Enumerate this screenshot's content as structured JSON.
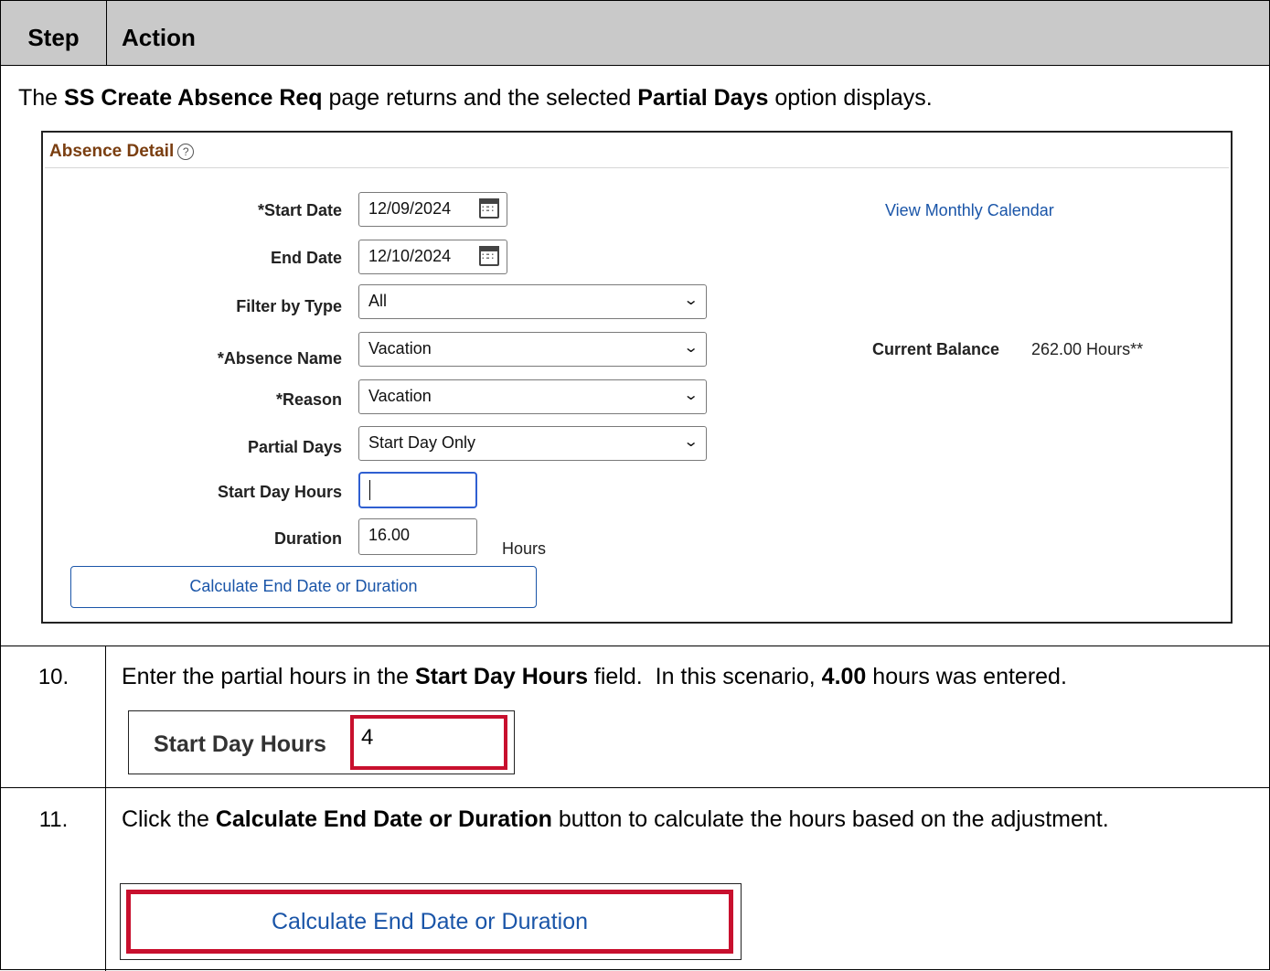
{
  "header": {
    "step": "Step",
    "action": "Action"
  },
  "intro": {
    "part1": "The ",
    "bold1": "SS Create Absence Req",
    "part2": " page returns and the selected ",
    "bold2": "Partial Days",
    "part3": " option displays."
  },
  "panel": {
    "title": "Absence Detail",
    "help_glyph": "?",
    "fields": {
      "start_date_label": "*Start Date",
      "start_date_value": "12/09/2024",
      "end_date_label": "End Date",
      "end_date_value": "12/10/2024",
      "filter_label": "Filter by Type",
      "filter_value": "All",
      "absence_name_label": "*Absence Name",
      "absence_name_value": "Vacation",
      "reason_label": "*Reason",
      "reason_value": "Vacation",
      "partial_days_label": "Partial Days",
      "partial_days_value": "Start Day Only",
      "start_day_hours_label": "Start Day Hours",
      "start_day_hours_value": "",
      "duration_label": "Duration",
      "duration_value": "16.00",
      "duration_unit": "Hours"
    },
    "view_calendar_link": "View Monthly Calendar",
    "balance_label": "Current Balance",
    "balance_value": "262.00 Hours**",
    "calculate_button": "Calculate End Date or Duration"
  },
  "steps": [
    {
      "number": "10.",
      "pre": "Enter the partial hours in the ",
      "bold1": "Start Day Hours",
      "mid": " field.  In this scenario, ",
      "bold2": "4.00",
      "post": " hours was entered.",
      "crop_label": "Start Day Hours",
      "crop_value": "4"
    },
    {
      "number": "11.",
      "pre": "Click the ",
      "bold1": "Calculate End Date or Duration",
      "post": " button to calculate the hours based on the adjustment.",
      "crop_button": "Calculate End Date or Duration"
    }
  ],
  "colors": {
    "header_bg": "#c9c9c9",
    "highlight": "#c8102e",
    "link": "#1a55a8",
    "panel_title": "#7a3e10"
  }
}
